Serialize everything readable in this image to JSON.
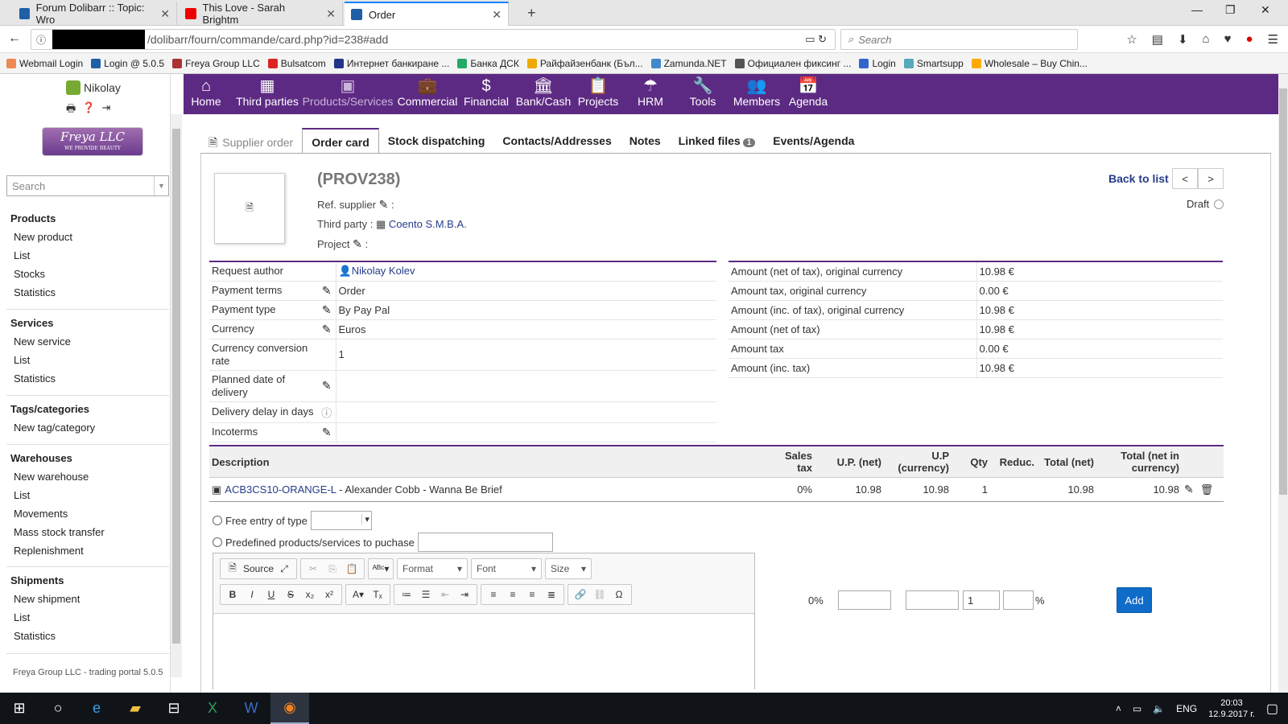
{
  "browser": {
    "tabs": [
      {
        "title": "Forum Dolibarr :: Topic: Wro",
        "color": "#1f5fa6"
      },
      {
        "title": "This Love - Sarah Brightm",
        "color": "#e00"
      },
      {
        "title": "Order",
        "color": "#1f5fa6"
      }
    ],
    "url": "/dolibarr/fourn/commande/card.php?id=238#add",
    "search_placeholder": "Search",
    "bookmarks": [
      "Webmail Login",
      "Login @ 5.0.5",
      "Freya Group LLC",
      "Bulsatcom",
      "Интернет банкиране ...",
      "Банка ДСК",
      "Райфайзенбанк (Бъл...",
      "Zamunda.NET",
      "Официален фиксинг ...",
      "Login",
      "Smartsupp",
      "Wholesale – Buy Chin..."
    ]
  },
  "left": {
    "user": "Nikolay",
    "logo_text": "Freya LLC",
    "logo_sub": "WE PROVIDE BEAUTY",
    "search_placeholder": "Search",
    "sections": [
      {
        "title": "Products",
        "items": [
          "New product",
          "List",
          "Stocks",
          "Statistics"
        ]
      },
      {
        "title": "Services",
        "items": [
          "New service",
          "List",
          "Statistics"
        ]
      },
      {
        "title": "Tags/categories",
        "items": [
          "New tag/category"
        ]
      },
      {
        "title": "Warehouses",
        "items": [
          "New warehouse",
          "List",
          "Movements",
          "Mass stock transfer",
          "Replenishment"
        ]
      },
      {
        "title": "Shipments",
        "items": [
          "New shipment",
          "List",
          "Statistics"
        ]
      }
    ],
    "footer": "Freya Group LLC - trading portal 5.0.5"
  },
  "topmenu": [
    {
      "label": "Home",
      "icon": "home-icon"
    },
    {
      "label": "Third parties",
      "icon": "building-icon"
    },
    {
      "label": "Products/Services",
      "icon": "cube-icon"
    },
    {
      "label": "Commercial",
      "icon": "briefcase-icon"
    },
    {
      "label": "Financial",
      "icon": "dollar-icon"
    },
    {
      "label": "Bank/Cash",
      "icon": "bank-icon"
    },
    {
      "label": "Projects",
      "icon": "clipboard-icon"
    },
    {
      "label": "HRM",
      "icon": "umbrella-icon"
    },
    {
      "label": "Tools",
      "icon": "wrench-icon"
    },
    {
      "label": "Members",
      "icon": "users-icon"
    },
    {
      "label": "Agenda",
      "icon": "calendar-icon"
    }
  ],
  "tabs": [
    "Supplier order",
    "Order card",
    "Stock dispatching",
    "Contacts/Addresses",
    "Notes",
    "Linked files",
    "Events/Agenda"
  ],
  "linked_files_count": "1",
  "order": {
    "ref": "(PROV238)",
    "ref_supplier_label": "Ref. supplier",
    "third_party_label": "Third party :",
    "third_party": "Coento S.M.B.A.",
    "project_label": "Project",
    "back_to_list": "Back to list",
    "status": "Draft"
  },
  "left_fields": [
    {
      "label": "Request author",
      "value": "Nikolay Kolev",
      "edit": false
    },
    {
      "label": "Payment terms",
      "value": "Order",
      "edit": true
    },
    {
      "label": "Payment type",
      "value": "By Pay Pal",
      "edit": true
    },
    {
      "label": "Currency",
      "value": "Euros",
      "edit": true
    },
    {
      "label": "Currency conversion rate",
      "value": "1",
      "edit": false
    },
    {
      "label": "Planned date of delivery",
      "value": "",
      "edit": true
    },
    {
      "label": "Delivery delay in days",
      "value": "",
      "edit": false
    },
    {
      "label": "Incoterms",
      "value": "",
      "edit": true
    }
  ],
  "amounts": [
    {
      "label": "Amount (net of tax), original currency",
      "value": "10.98 €"
    },
    {
      "label": "Amount tax, original currency",
      "value": "0.00 €"
    },
    {
      "label": "Amount (inc. of tax), original currency",
      "value": "10.98 €"
    },
    {
      "label": "Amount (net of tax)",
      "value": "10.98 €"
    },
    {
      "label": "Amount tax",
      "value": "0.00 €"
    },
    {
      "label": "Amount (inc. tax)",
      "value": "10.98 €"
    }
  ],
  "lines": {
    "headers": [
      "Description",
      "Sales tax",
      "U.P. (net)",
      "U.P (currency)",
      "Qty",
      "Reduc.",
      "Total (net)",
      "Total (net in currency)"
    ],
    "rows": [
      {
        "ref": "ACB3CS10-ORANGE-L",
        "desc": " - Alexander Cobb - Wanna Be Brief",
        "tax": "0%",
        "up": "10.98",
        "upc": "10.98",
        "qty": "1",
        "reduc": "",
        "total": "10.98",
        "totalc": "10.98"
      }
    ]
  },
  "add_line": {
    "free_entry": "Free entry of type",
    "predefined": "Predefined products/services to puchase",
    "tax": "0%",
    "qty": "1",
    "percent": "%",
    "add": "Add",
    "editor_source": "Source",
    "editor_format": "Format",
    "editor_font": "Font",
    "editor_size": "Size"
  },
  "taskbar": {
    "lang": "ENG",
    "time": "20:03",
    "date": "12.9.2017 г."
  }
}
